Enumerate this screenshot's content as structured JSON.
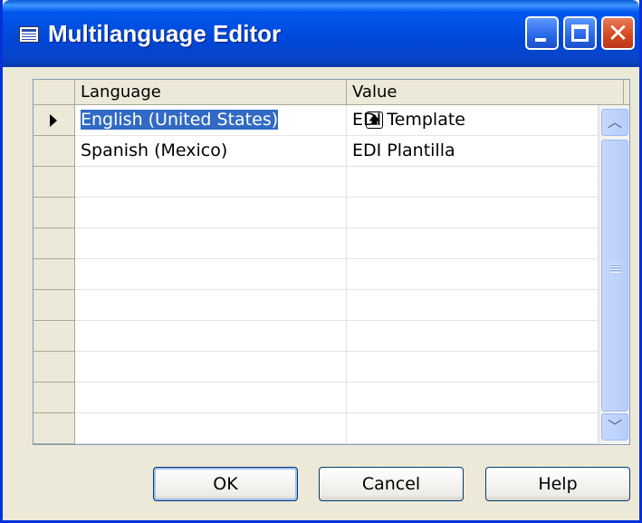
{
  "window": {
    "title": "Multilanguage Editor"
  },
  "grid": {
    "columns": [
      "Language",
      "Value"
    ],
    "rows": [
      {
        "language": "English (United States)",
        "value": "EDI Template",
        "selected": true
      },
      {
        "language": "Spanish (Mexico)",
        "value": "EDI Plantilla",
        "selected": false
      },
      {
        "language": "",
        "value": ""
      },
      {
        "language": "",
        "value": ""
      },
      {
        "language": "",
        "value": ""
      },
      {
        "language": "",
        "value": ""
      },
      {
        "language": "",
        "value": ""
      },
      {
        "language": "",
        "value": ""
      },
      {
        "language": "",
        "value": ""
      },
      {
        "language": "",
        "value": ""
      },
      {
        "language": "",
        "value": ""
      }
    ]
  },
  "buttons": {
    "ok": "OK",
    "cancel": "Cancel",
    "help": "Help"
  },
  "icons": {
    "app": "table-icon",
    "lookup": "lookup-up-arrow-icon",
    "row_pointer": "row-pointer-icon",
    "minimize": "minimize-icon",
    "maximize": "maximize-icon",
    "close": "close-icon"
  },
  "colors": {
    "titlebar": "#0058ee",
    "selection": "#316ac5",
    "close_button": "#d5461d"
  }
}
